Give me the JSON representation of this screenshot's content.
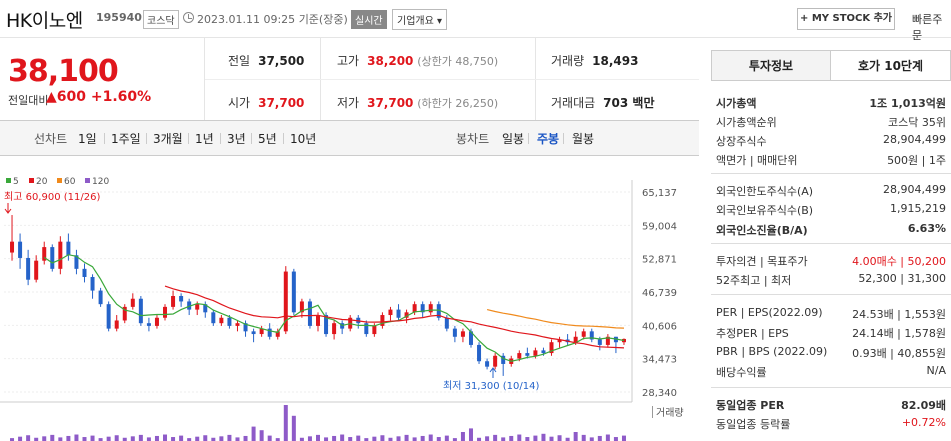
{
  "header": {
    "name": "HK이노엔",
    "code": "195940",
    "market": "코스닥",
    "datetime": "2023.01.11 09:25",
    "basis": "기준(장중)",
    "live": "실시간",
    "company_info": "기업개요",
    "mystock": "+ MY STOCK 추가",
    "quick_order": "빠른주문"
  },
  "price": {
    "current": "38,100",
    "change_label": "전일대비",
    "change": "▲600",
    "change_pct": "+1.60%"
  },
  "quote": {
    "prev_label": "전일",
    "prev": "37,500",
    "high_label": "고가",
    "high": "38,200",
    "high_sub": "(상한가 48,750)",
    "volume_label": "거래량",
    "volume": "18,493",
    "open_label": "시가",
    "open": "37,700",
    "low_label": "저가",
    "low": "37,700",
    "low_sub": "(하한가 26,250)",
    "amount_label": "거래대금",
    "amount": "703 백만"
  },
  "periods": {
    "line_label": "선차트",
    "items": [
      "1일",
      "1주일",
      "3개월",
      "1년",
      "3년",
      "5년",
      "10년"
    ],
    "candle_label": "봉차트",
    "candle_items": [
      "일봉",
      "주봉",
      "월봉"
    ],
    "selected_candle": "주봉"
  },
  "chart_data": {
    "type": "candlestick",
    "legend": [
      "5",
      "20",
      "60",
      "120"
    ],
    "colors": {
      "ma5": "#3aa83a",
      "ma20": "#e0161c",
      "ma60": "#f08a1c",
      "ma120": "#8e5bc8",
      "up": "#e0161c",
      "down": "#2563c9"
    },
    "y_ticks": [
      "65,137",
      "59,004",
      "52,871",
      "46,739",
      "40,606",
      "34,473",
      "28,340"
    ],
    "ylim": [
      28340,
      65137
    ],
    "high_label": "최고 60,900 (11/26)",
    "low_label": "최저 31,300 (10/14)",
    "volume_label": "거래량",
    "candles": [
      [
        54000,
        56000,
        60900,
        52500
      ],
      [
        56000,
        53000,
        57500,
        51000
      ],
      [
        53000,
        49000,
        54500,
        48000
      ],
      [
        49000,
        52500,
        53500,
        48500
      ],
      [
        52500,
        55000,
        56000,
        51800
      ],
      [
        55000,
        51000,
        55500,
        50500
      ],
      [
        51000,
        56000,
        57000,
        50000
      ],
      [
        56000,
        53500,
        57500,
        52500
      ],
      [
        53500,
        51000,
        54500,
        50000
      ],
      [
        51000,
        49500,
        52000,
        48500
      ],
      [
        49500,
        47000,
        50000,
        45500
      ],
      [
        47000,
        44500,
        47500,
        44000
      ],
      [
        44500,
        40000,
        45000,
        39500
      ],
      [
        40000,
        41500,
        42500,
        39500
      ],
      [
        41500,
        44000,
        44500,
        41000
      ],
      [
        44000,
        45500,
        46500,
        43500
      ],
      [
        45500,
        41000,
        46000,
        40500
      ],
      [
        41000,
        40500,
        42000,
        39500
      ],
      [
        40500,
        42000,
        42500,
        40000
      ],
      [
        42000,
        44000,
        44500,
        41500
      ],
      [
        44000,
        46000,
        47000,
        43500
      ],
      [
        46000,
        45000,
        46500,
        44000
      ],
      [
        45000,
        43500,
        45500,
        42500
      ],
      [
        43500,
        44500,
        45000,
        42500
      ],
      [
        44500,
        43000,
        45000,
        42000
      ],
      [
        43000,
        41000,
        43500,
        40500
      ],
      [
        41000,
        42000,
        42500,
        40500
      ],
      [
        42000,
        40500,
        42500,
        40000
      ],
      [
        40500,
        41000,
        41500,
        39500
      ],
      [
        41000,
        39500,
        41500,
        38500
      ],
      [
        39500,
        39000,
        40000,
        37500
      ],
      [
        39000,
        40000,
        40500,
        38500
      ],
      [
        40000,
        38500,
        41000,
        38000
      ],
      [
        38500,
        39500,
        40000,
        38000
      ],
      [
        39500,
        50500,
        51500,
        39000
      ],
      [
        50500,
        43000,
        51000,
        42500
      ],
      [
        43000,
        45000,
        45500,
        42000
      ],
      [
        45000,
        40500,
        45500,
        40000
      ],
      [
        40500,
        42500,
        43000,
        39500
      ],
      [
        42500,
        39000,
        43000,
        38500
      ],
      [
        39000,
        41000,
        41500,
        38000
      ],
      [
        41000,
        40000,
        41500,
        39000
      ],
      [
        40000,
        42000,
        42500,
        39500
      ],
      [
        42000,
        41000,
        42500,
        40000
      ],
      [
        41000,
        39000,
        41500,
        38500
      ],
      [
        39000,
        40500,
        41000,
        38500
      ],
      [
        40500,
        42500,
        43000,
        40000
      ],
      [
        42500,
        43500,
        44000,
        41500
      ],
      [
        43500,
        42000,
        44500,
        41500
      ],
      [
        42000,
        43000,
        43500,
        41000
      ],
      [
        43000,
        44500,
        45000,
        42500
      ],
      [
        44500,
        43000,
        45000,
        42000
      ],
      [
        43000,
        44500,
        45000,
        42500
      ],
      [
        44500,
        42000,
        45000,
        41500
      ],
      [
        42000,
        40000,
        42500,
        39500
      ],
      [
        40000,
        38500,
        40500,
        37500
      ],
      [
        38500,
        39500,
        40000,
        37500
      ],
      [
        39500,
        37000,
        40000,
        36500
      ],
      [
        37000,
        34000,
        37500,
        33500
      ],
      [
        34000,
        33000,
        34500,
        32500
      ],
      [
        33000,
        35000,
        35500,
        32500
      ],
      [
        35000,
        33500,
        35500,
        31300
      ],
      [
        33500,
        34500,
        35000,
        33000
      ],
      [
        34500,
        35500,
        36000,
        34000
      ],
      [
        35500,
        35000,
        36500,
        34500
      ],
      [
        35000,
        36000,
        36500,
        34500
      ],
      [
        36000,
        35500,
        36500,
        35000
      ],
      [
        35500,
        37500,
        38000,
        35000
      ],
      [
        37500,
        38000,
        38500,
        36500
      ],
      [
        38000,
        37500,
        39000,
        37000
      ],
      [
        37500,
        38500,
        39500,
        37000
      ],
      [
        38500,
        39500,
        40000,
        38000
      ],
      [
        39500,
        38000,
        40000,
        37500
      ],
      [
        38000,
        37000,
        38500,
        36000
      ],
      [
        37000,
        38500,
        39000,
        36500
      ],
      [
        38500,
        37500,
        38500,
        35500
      ],
      [
        37500,
        38100,
        38200,
        37000
      ]
    ]
  },
  "side": {
    "tab_invest": "투자정보",
    "tab_hoga": "호가 10단계",
    "rows": [
      {
        "k": "시가총액",
        "v": "1조 1,013억원",
        "bold": true
      },
      {
        "k": "시가총액순위",
        "v": "코스닥 35위"
      },
      {
        "k": "상장주식수",
        "v": "28,904,499"
      },
      {
        "k": "액면가 | 매매단위",
        "v": "500원 | 1주"
      },
      {
        "k": "외국인한도주식수(A)",
        "v": "28,904,499"
      },
      {
        "k": "외국인보유주식수(B)",
        "v": "1,915,219"
      },
      {
        "k": "외국인소진율(B/A)",
        "v": "6.63%",
        "bold": true
      },
      {
        "k": "투자의견 | 목표주가",
        "v": "4.00매수 | 50,200",
        "red": true
      },
      {
        "k": "52주최고 | 최저",
        "v": "52,300 | 31,300"
      },
      {
        "k": "PER | EPS(2022.09)",
        "v": "24.53배 | 1,553원"
      },
      {
        "k": "추정PER | EPS",
        "v": "24.14배 | 1,578원"
      },
      {
        "k": "PBR | BPS (2022.09)",
        "v": "0.93배 | 40,855원"
      },
      {
        "k": "배당수익률",
        "v": "N/A"
      },
      {
        "k": "동일업종 PER",
        "v": "82.09배",
        "bold": true
      },
      {
        "k": "동일업종 등락률",
        "v": "+0.72%",
        "red": true
      }
    ]
  }
}
